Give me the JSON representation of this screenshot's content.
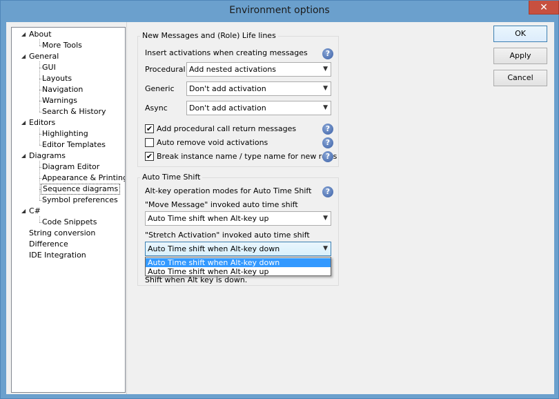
{
  "window": {
    "title": "Environment options",
    "close_glyph": "✕"
  },
  "tree": {
    "items": [
      {
        "label": "About",
        "expanded": true
      },
      {
        "label": "More Tools"
      },
      {
        "label": "General",
        "expanded": true
      },
      {
        "label": "GUI"
      },
      {
        "label": "Layouts"
      },
      {
        "label": "Navigation"
      },
      {
        "label": "Warnings"
      },
      {
        "label": "Search & History"
      },
      {
        "label": "Editors",
        "expanded": true
      },
      {
        "label": "Highlighting"
      },
      {
        "label": "Editor Templates"
      },
      {
        "label": "Diagrams",
        "expanded": true
      },
      {
        "label": "Diagram Editor"
      },
      {
        "label": "Appearance & Printing"
      },
      {
        "label": "Sequence diagrams",
        "selected": true
      },
      {
        "label": "Symbol preferences"
      },
      {
        "label": "C#",
        "expanded": true
      },
      {
        "label": "Code Snippets"
      },
      {
        "label": "String conversion"
      },
      {
        "label": "Difference"
      },
      {
        "label": "IDE Integration"
      }
    ],
    "expander_glyph": "◢"
  },
  "messages_group": {
    "title": "New Messages and (Role) Life lines",
    "insert_label": "Insert activations when creating messages",
    "procedural_label": "Procedural",
    "procedural_value": "Add nested activations",
    "generic_label": "Generic",
    "generic_value": "Don't add activation",
    "async_label": "Async",
    "async_value": "Don't add activation",
    "checks": [
      {
        "label": "Add procedural call return messages",
        "checked": true
      },
      {
        "label": "Auto remove void activations",
        "checked": false
      },
      {
        "label": "Break instance name / type name for new roles",
        "checked": true
      }
    ]
  },
  "time_shift_group": {
    "title": "Auto Time Shift",
    "altkey_label": "Alt-key operation modes for Auto Time Shift",
    "move_label": "\"Move Message\" invoked auto time shift",
    "move_value": "Auto Time shift when Alt-key up",
    "stretch_label": "\"Stretch Activation\" invoked auto time shift",
    "stretch_value": "Auto Time shift when Alt-key down",
    "dropdown_options": [
      "Auto Time shift when Alt-key down",
      "Auto Time shift when Alt-key up"
    ],
    "obscured_text": "Shift when Alt key is down."
  },
  "buttons": {
    "ok": "OK",
    "apply": "Apply",
    "cancel": "Cancel"
  },
  "icons": {
    "help": "?",
    "check": "✔",
    "combo_arrow": "▼"
  },
  "colors": {
    "frame": "#6ba0cd",
    "close": "#c7503f",
    "selection": "#3399ff"
  }
}
